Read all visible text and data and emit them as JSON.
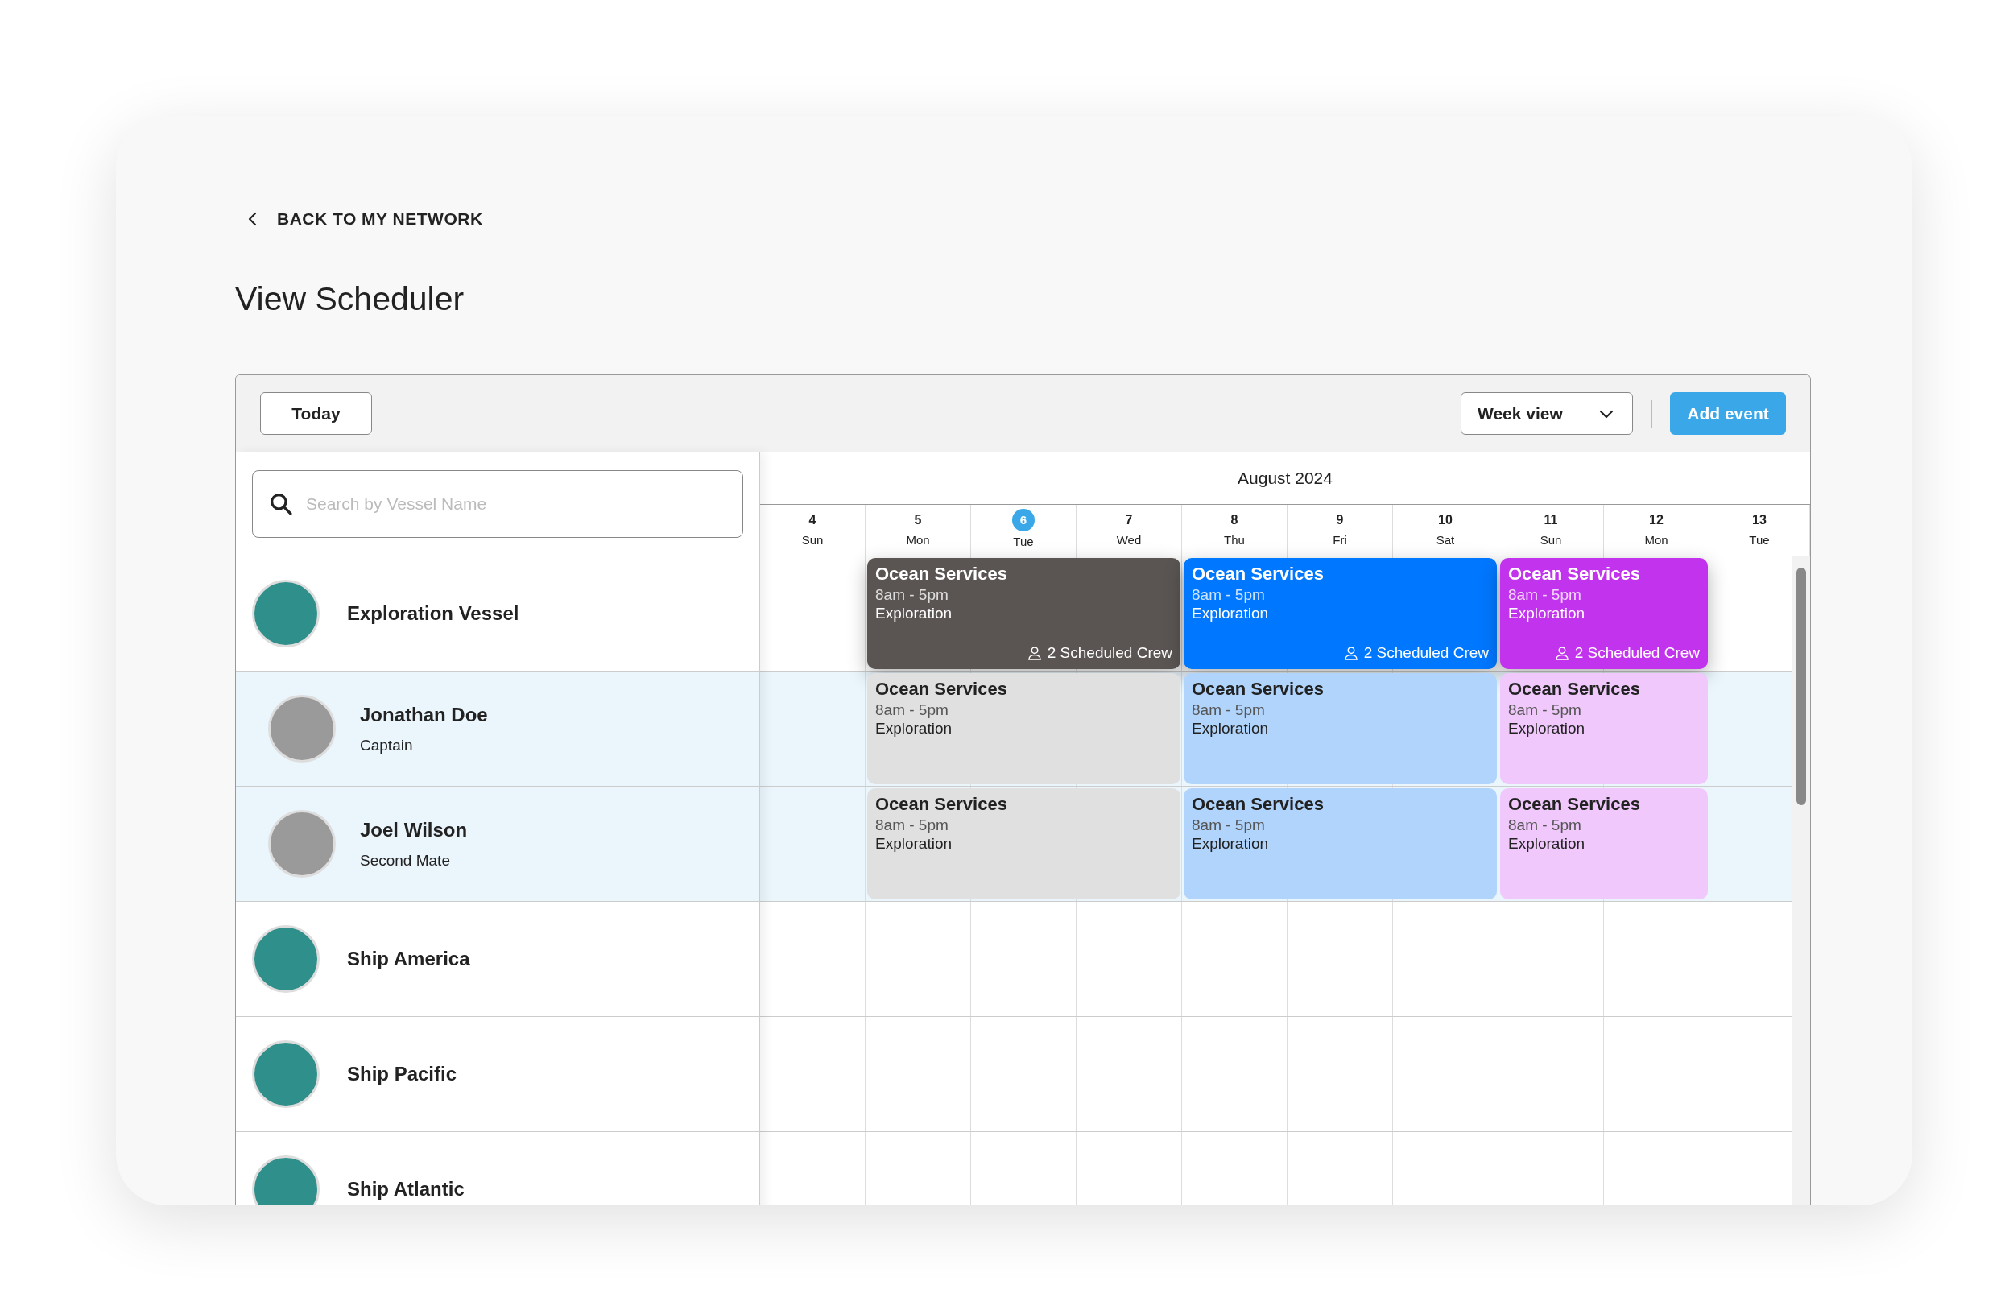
{
  "back_link": {
    "label": "BACK TO MY NETWORK"
  },
  "page_title": "View Scheduler",
  "toolbar": {
    "today_button": "Today",
    "view_select": {
      "value": "Week view"
    },
    "add_button": "Add event"
  },
  "search": {
    "placeholder": "Search by Vessel Name"
  },
  "month": "August 2024",
  "days": [
    {
      "number": "4",
      "weekday": "Sun",
      "selected": false
    },
    {
      "number": "5",
      "weekday": "Mon",
      "selected": false
    },
    {
      "number": "6",
      "weekday": "Tue",
      "selected": true
    },
    {
      "number": "7",
      "weekday": "Wed",
      "selected": false
    },
    {
      "number": "8",
      "weekday": "Thu",
      "selected": false
    },
    {
      "number": "9",
      "weekday": "Fri",
      "selected": false
    },
    {
      "number": "10",
      "weekday": "Sat",
      "selected": false
    },
    {
      "number": "11",
      "weekday": "Sun",
      "selected": false
    },
    {
      "number": "12",
      "weekday": "Mon",
      "selected": false
    },
    {
      "number": "13",
      "weekday": "Tue",
      "selected": false
    }
  ],
  "rows": [
    {
      "kind": "vessel",
      "name": "Exploration Vessel",
      "events": [
        {
          "title": "Ocean Services",
          "time": "8am - 5pm",
          "label": "Exploration",
          "crew": "2 Scheduled Crew",
          "color": "#5a5553"
        },
        {
          "title": "Ocean Services",
          "time": "8am - 5pm",
          "label": "Exploration",
          "crew": "2 Scheduled Crew",
          "color": "#0077ff"
        },
        {
          "title": "Ocean Services",
          "time": "8am - 5pm",
          "label": "Exploration",
          "crew": "2 Scheduled Crew",
          "color": "#c233ee"
        }
      ]
    },
    {
      "kind": "crew",
      "name": "Jonathan Doe",
      "role": "Captain",
      "events": [
        {
          "title": "Ocean Services",
          "time": "8am - 5pm",
          "label": "Exploration",
          "color": "#e0e0e0"
        },
        {
          "title": "Ocean Services",
          "time": "8am - 5pm",
          "label": "Exploration",
          "color": "#b0d4fc"
        },
        {
          "title": "Ocean Services",
          "time": "8am - 5pm",
          "label": "Exploration",
          "color": "#f0c8fc"
        }
      ]
    },
    {
      "kind": "crew",
      "name": "Joel Wilson",
      "role": "Second Mate",
      "events": [
        {
          "title": "Ocean Services",
          "time": "8am - 5pm",
          "label": "Exploration",
          "color": "#e0e0e0"
        },
        {
          "title": "Ocean Services",
          "time": "8am - 5pm",
          "label": "Exploration",
          "color": "#b0d4fc"
        },
        {
          "title": "Ocean Services",
          "time": "8am - 5pm",
          "label": "Exploration",
          "color": "#f0c8fc"
        }
      ]
    },
    {
      "kind": "vessel",
      "name": "Ship America",
      "events": []
    },
    {
      "kind": "vessel",
      "name": "Ship Pacific",
      "events": []
    },
    {
      "kind": "vessel",
      "name": "Ship Atlantic",
      "events": []
    }
  ]
}
